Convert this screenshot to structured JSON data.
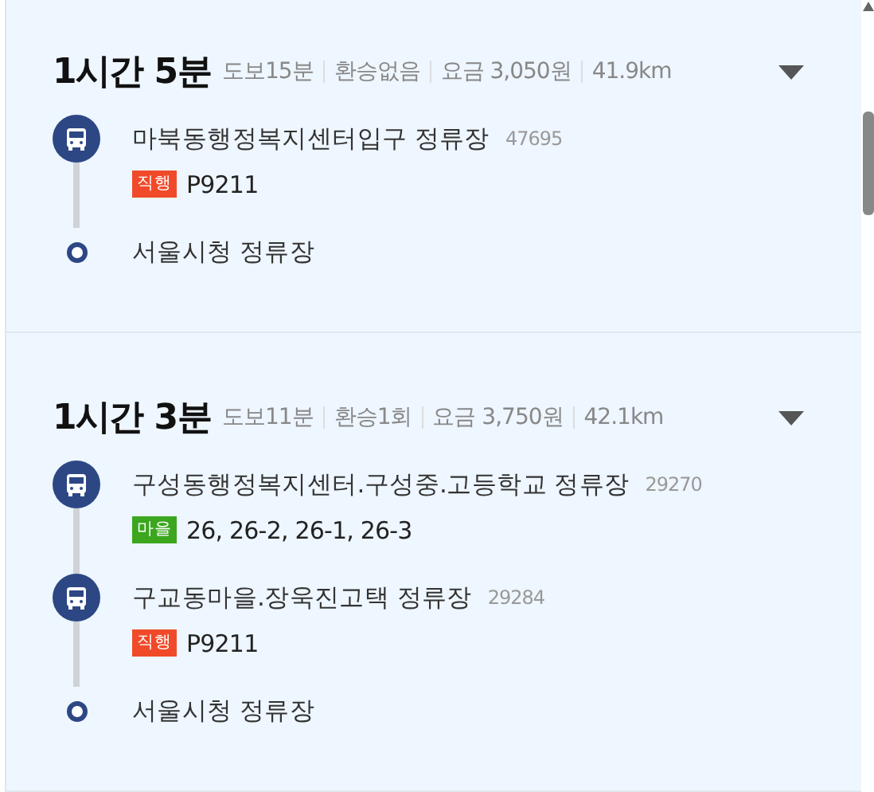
{
  "routes": [
    {
      "duration": "1시간 5분",
      "meta": [
        "도보15분",
        "환승없음",
        "요금 3,050원",
        "41.9km"
      ],
      "stops": [
        {
          "kind": "bus",
          "name": "마북동행정복지센터입구 정류장",
          "code": "47695",
          "tag": {
            "label": "직행",
            "color": "#f04a2a"
          },
          "buses": "P9211"
        },
        {
          "kind": "end",
          "name": "서울시청 정류장"
        }
      ]
    },
    {
      "duration": "1시간 3분",
      "meta": [
        "도보11분",
        "환승1회",
        "요금 3,750원",
        "42.1km"
      ],
      "stops": [
        {
          "kind": "bus",
          "name": "구성동행정복지센터.구성중.고등학교 정류장",
          "code": "29270",
          "tag": {
            "label": "마을",
            "color": "#3ca61f"
          },
          "buses": "26, 26-2, 26-1, 26-3"
        },
        {
          "kind": "bus",
          "name": "구교동마을.장욱진고택 정류장",
          "code": "29284",
          "tag": {
            "label": "직행",
            "color": "#f04a2a"
          },
          "buses": "P9211"
        },
        {
          "kind": "end",
          "name": "서울시청 정류장"
        }
      ]
    }
  ]
}
